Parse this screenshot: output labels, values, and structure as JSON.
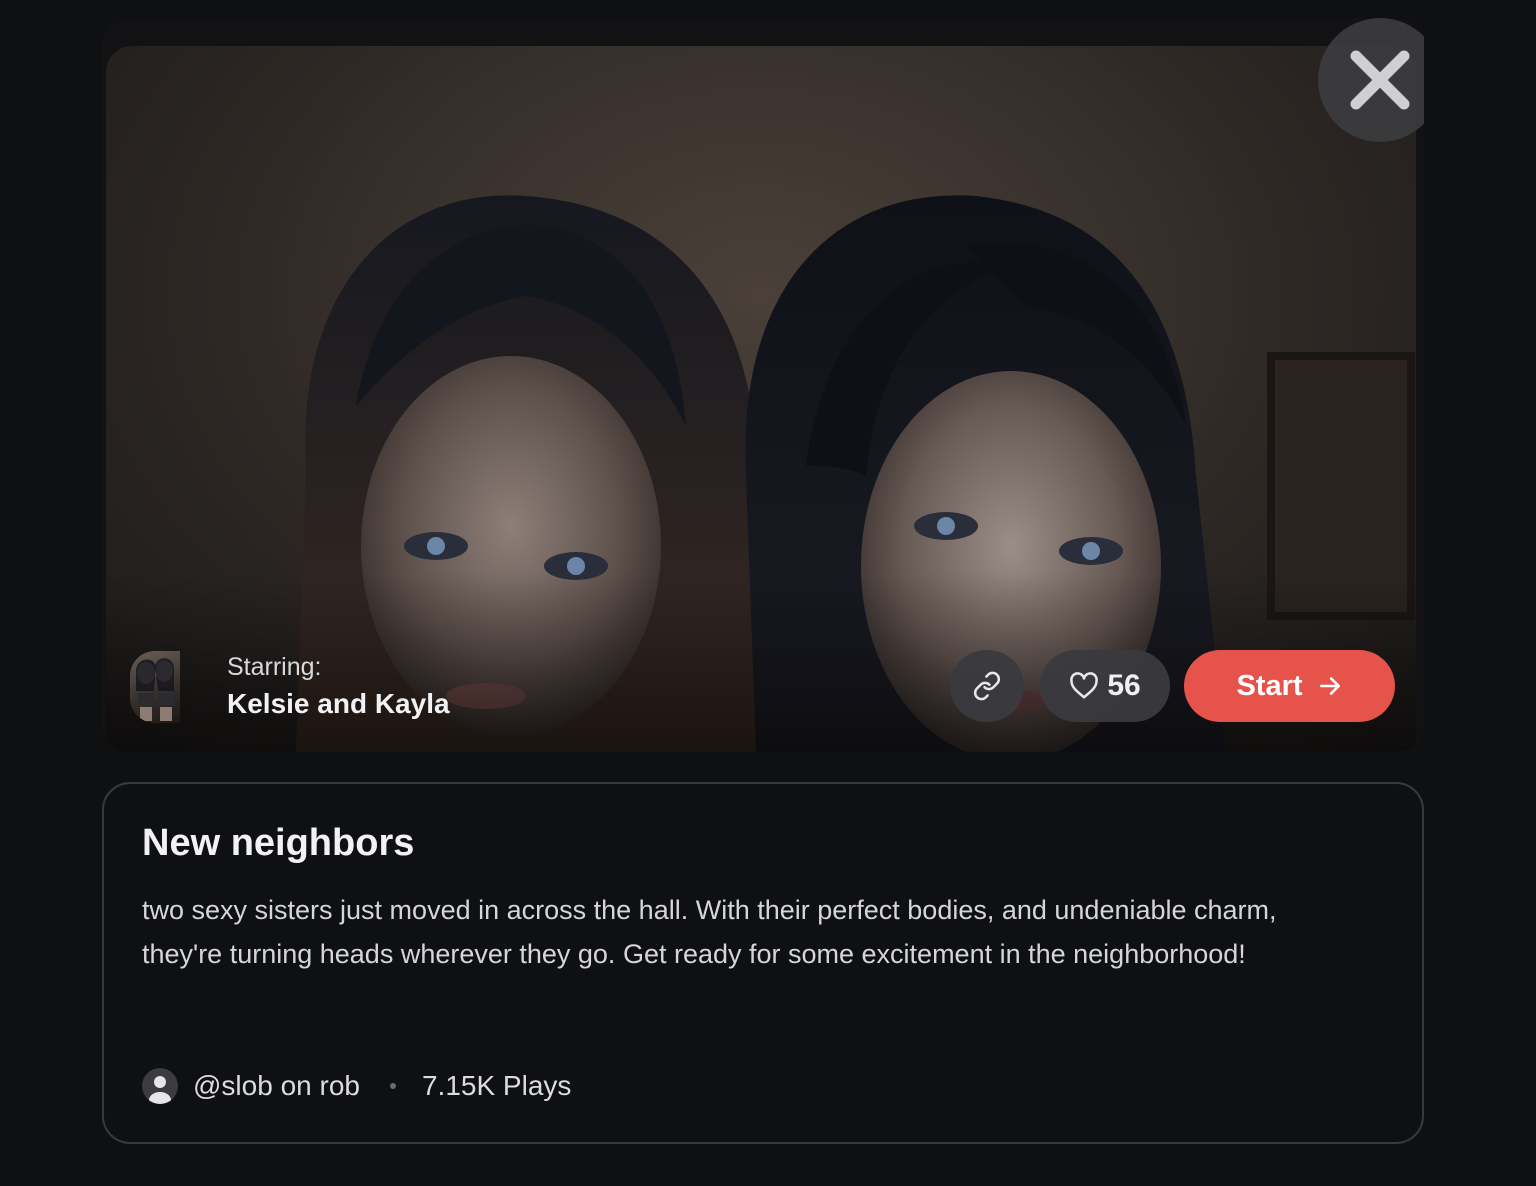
{
  "hero": {
    "close_icon": "close-icon",
    "starring_label": "Starring:",
    "starring_names": "Kelsie and Kayla",
    "link_icon": "link-icon",
    "heart_icon": "heart-icon",
    "like_count": "56",
    "start_label": "Start",
    "start_icon": "arrow-right-icon"
  },
  "story": {
    "title": "New neighbors",
    "description": "two sexy sisters just moved in across the hall. With their perfect bodies, and undeniable charm, they're turning heads wherever they go. Get ready for some excitement in the neighborhood!",
    "author": "@slob on rob",
    "plays": "7.15K Plays"
  },
  "colors": {
    "background": "#0f1012",
    "accent": "#e5534b",
    "card_border": "#3a3a3e",
    "pill": "#3a3a3e"
  }
}
